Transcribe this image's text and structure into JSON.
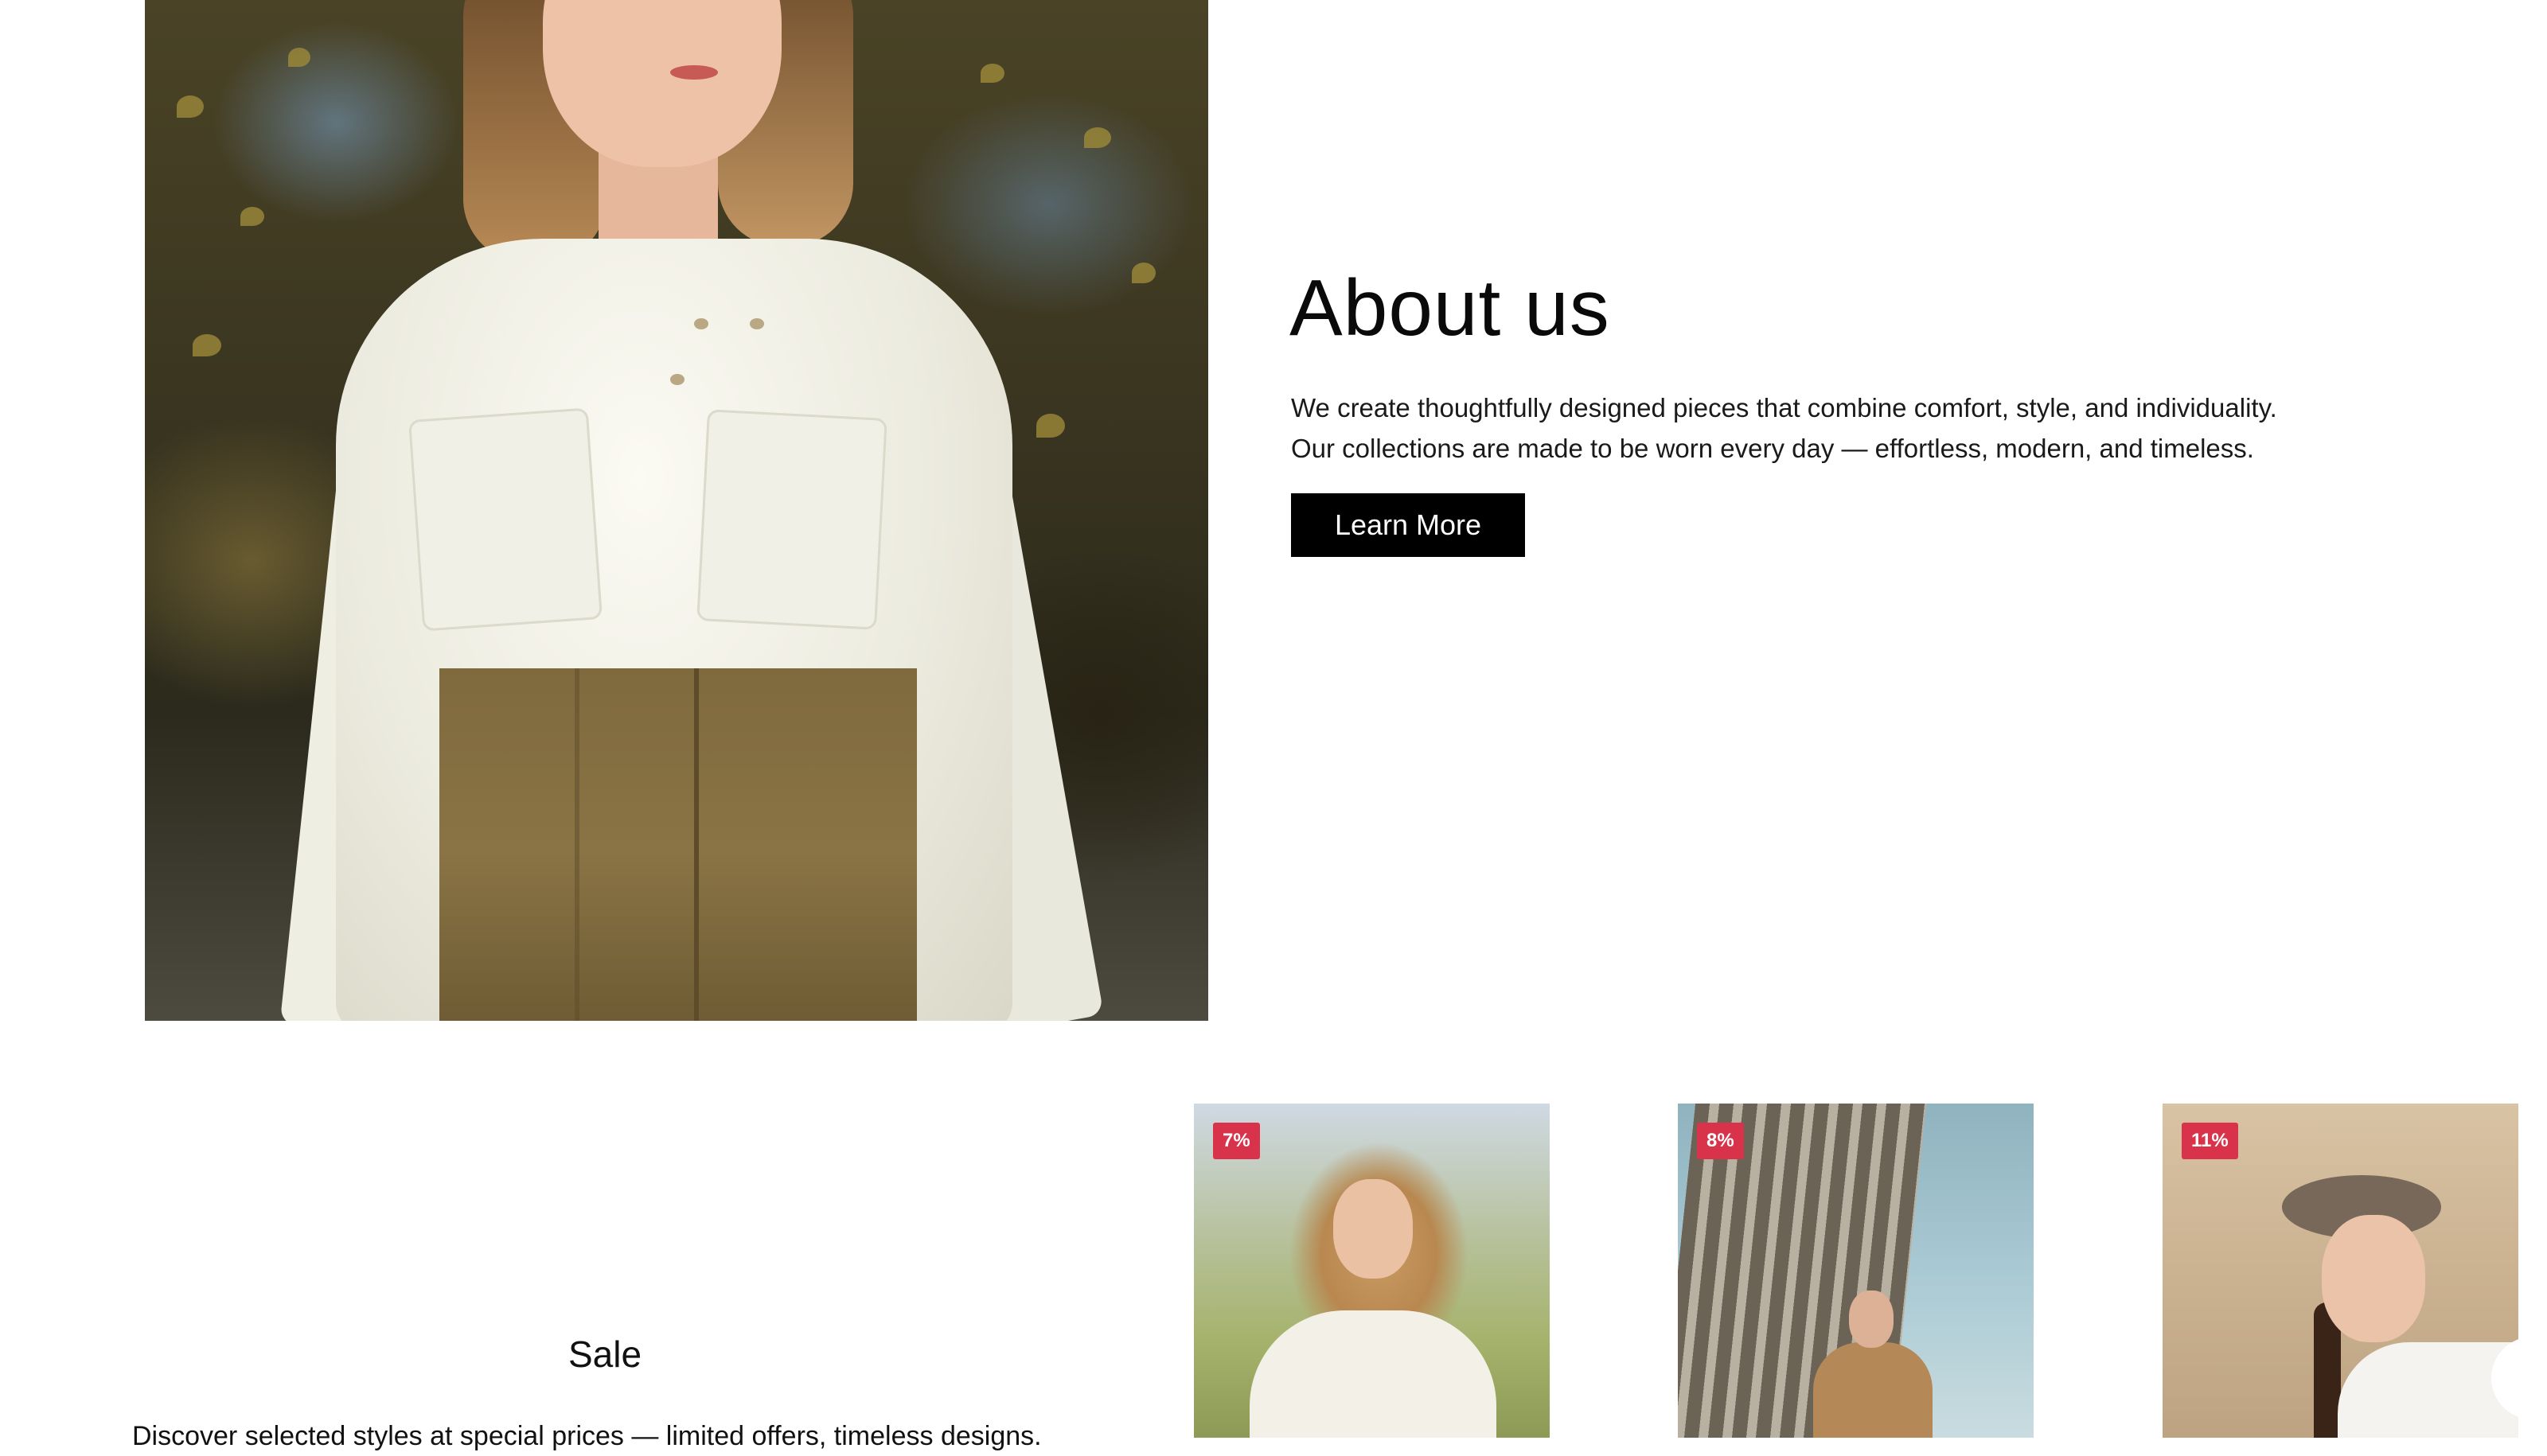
{
  "about": {
    "title": "About us",
    "text_line1": "We create thoughtfully designed pieces that combine comfort, style, and individuality.",
    "text_line2": "Our collections are made to be worn every day — effortless, modern, and timeless.",
    "button_label": "Learn More"
  },
  "sale": {
    "title": "Sale",
    "text": "Discover selected styles at special prices — limited offers, timeless designs.",
    "products": [
      {
        "discount": "7%"
      },
      {
        "discount": "8%"
      },
      {
        "discount": "11%"
      }
    ],
    "badge_color": "#d8334a"
  }
}
